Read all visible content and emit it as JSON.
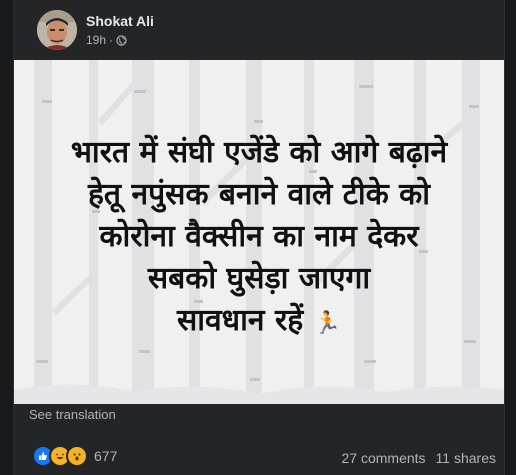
{
  "post": {
    "author": "Shokat Ali",
    "time": "19h",
    "audience_icon": "globe-icon",
    "text_lines": [
      "भारत में संघी एजेंडे को आगे बढ़ाने",
      "हेतू नपुंसक बनाने वाले टीके को",
      "कोरोना वैक्सीन का नाम देकर",
      "सबको घुसेड़ा जाएगा",
      "सावधान रहें"
    ],
    "emoji": "🏃",
    "see_translation": "See translation"
  },
  "engagement": {
    "reactions": [
      "like-icon",
      "haha-icon",
      "wow-icon"
    ],
    "reaction_count": "677",
    "comments": "27 comments",
    "shares": "11 shares"
  },
  "colors": {
    "page_bg": "#18191a",
    "card_bg": "#242526",
    "text_primary": "#e4e6eb",
    "text_secondary": "#b0b3b8",
    "like_blue": "#1877f2",
    "reaction_yellow": "#f7b125"
  }
}
